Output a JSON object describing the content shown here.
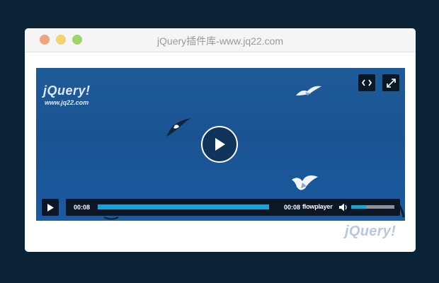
{
  "window": {
    "title": "jQuery插件库-www.jq22.com"
  },
  "video_logo": {
    "main": "jQuery!",
    "sub": "www.jq22.com"
  },
  "top_buttons": {
    "embed_icon": "embed-code-icon",
    "fullscreen_icon": "fullscreen-icon"
  },
  "player": {
    "big_play_icon": "play-icon",
    "time_elapsed": "00:08",
    "time_duration": "00:08",
    "brand": "flowplayer",
    "progress": 1.0,
    "volume": 0.34
  },
  "watermark": "jQuery!",
  "colors": {
    "page_bg": "#0a2336",
    "accent": "#14a4d8",
    "control_bg": "#0c1726",
    "video_sky": "#1b5a9c"
  }
}
